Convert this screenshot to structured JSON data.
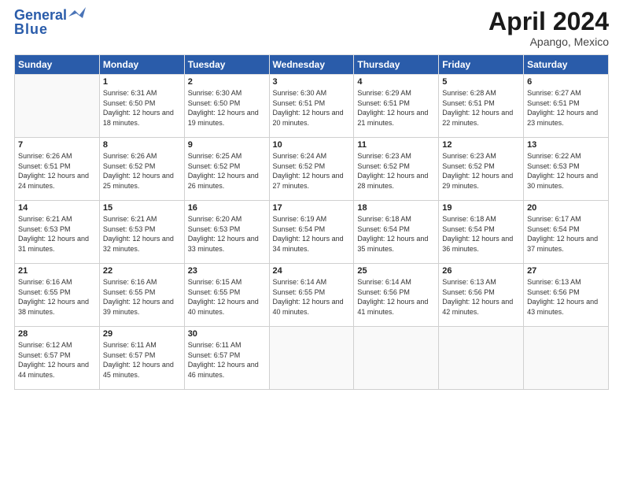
{
  "header": {
    "logo_general": "General",
    "logo_blue": "Blue",
    "title": "April 2024",
    "location": "Apango, Mexico"
  },
  "weekdays": [
    "Sunday",
    "Monday",
    "Tuesday",
    "Wednesday",
    "Thursday",
    "Friday",
    "Saturday"
  ],
  "weeks": [
    [
      {
        "day": "",
        "sunrise": "",
        "sunset": "",
        "daylight": ""
      },
      {
        "day": "1",
        "sunrise": "Sunrise: 6:31 AM",
        "sunset": "Sunset: 6:50 PM",
        "daylight": "Daylight: 12 hours and 18 minutes."
      },
      {
        "day": "2",
        "sunrise": "Sunrise: 6:30 AM",
        "sunset": "Sunset: 6:50 PM",
        "daylight": "Daylight: 12 hours and 19 minutes."
      },
      {
        "day": "3",
        "sunrise": "Sunrise: 6:30 AM",
        "sunset": "Sunset: 6:51 PM",
        "daylight": "Daylight: 12 hours and 20 minutes."
      },
      {
        "day": "4",
        "sunrise": "Sunrise: 6:29 AM",
        "sunset": "Sunset: 6:51 PM",
        "daylight": "Daylight: 12 hours and 21 minutes."
      },
      {
        "day": "5",
        "sunrise": "Sunrise: 6:28 AM",
        "sunset": "Sunset: 6:51 PM",
        "daylight": "Daylight: 12 hours and 22 minutes."
      },
      {
        "day": "6",
        "sunrise": "Sunrise: 6:27 AM",
        "sunset": "Sunset: 6:51 PM",
        "daylight": "Daylight: 12 hours and 23 minutes."
      }
    ],
    [
      {
        "day": "7",
        "sunrise": "Sunrise: 6:26 AM",
        "sunset": "Sunset: 6:51 PM",
        "daylight": "Daylight: 12 hours and 24 minutes."
      },
      {
        "day": "8",
        "sunrise": "Sunrise: 6:26 AM",
        "sunset": "Sunset: 6:52 PM",
        "daylight": "Daylight: 12 hours and 25 minutes."
      },
      {
        "day": "9",
        "sunrise": "Sunrise: 6:25 AM",
        "sunset": "Sunset: 6:52 PM",
        "daylight": "Daylight: 12 hours and 26 minutes."
      },
      {
        "day": "10",
        "sunrise": "Sunrise: 6:24 AM",
        "sunset": "Sunset: 6:52 PM",
        "daylight": "Daylight: 12 hours and 27 minutes."
      },
      {
        "day": "11",
        "sunrise": "Sunrise: 6:23 AM",
        "sunset": "Sunset: 6:52 PM",
        "daylight": "Daylight: 12 hours and 28 minutes."
      },
      {
        "day": "12",
        "sunrise": "Sunrise: 6:23 AM",
        "sunset": "Sunset: 6:52 PM",
        "daylight": "Daylight: 12 hours and 29 minutes."
      },
      {
        "day": "13",
        "sunrise": "Sunrise: 6:22 AM",
        "sunset": "Sunset: 6:53 PM",
        "daylight": "Daylight: 12 hours and 30 minutes."
      }
    ],
    [
      {
        "day": "14",
        "sunrise": "Sunrise: 6:21 AM",
        "sunset": "Sunset: 6:53 PM",
        "daylight": "Daylight: 12 hours and 31 minutes."
      },
      {
        "day": "15",
        "sunrise": "Sunrise: 6:21 AM",
        "sunset": "Sunset: 6:53 PM",
        "daylight": "Daylight: 12 hours and 32 minutes."
      },
      {
        "day": "16",
        "sunrise": "Sunrise: 6:20 AM",
        "sunset": "Sunset: 6:53 PM",
        "daylight": "Daylight: 12 hours and 33 minutes."
      },
      {
        "day": "17",
        "sunrise": "Sunrise: 6:19 AM",
        "sunset": "Sunset: 6:54 PM",
        "daylight": "Daylight: 12 hours and 34 minutes."
      },
      {
        "day": "18",
        "sunrise": "Sunrise: 6:18 AM",
        "sunset": "Sunset: 6:54 PM",
        "daylight": "Daylight: 12 hours and 35 minutes."
      },
      {
        "day": "19",
        "sunrise": "Sunrise: 6:18 AM",
        "sunset": "Sunset: 6:54 PM",
        "daylight": "Daylight: 12 hours and 36 minutes."
      },
      {
        "day": "20",
        "sunrise": "Sunrise: 6:17 AM",
        "sunset": "Sunset: 6:54 PM",
        "daylight": "Daylight: 12 hours and 37 minutes."
      }
    ],
    [
      {
        "day": "21",
        "sunrise": "Sunrise: 6:16 AM",
        "sunset": "Sunset: 6:55 PM",
        "daylight": "Daylight: 12 hours and 38 minutes."
      },
      {
        "day": "22",
        "sunrise": "Sunrise: 6:16 AM",
        "sunset": "Sunset: 6:55 PM",
        "daylight": "Daylight: 12 hours and 39 minutes."
      },
      {
        "day": "23",
        "sunrise": "Sunrise: 6:15 AM",
        "sunset": "Sunset: 6:55 PM",
        "daylight": "Daylight: 12 hours and 40 minutes."
      },
      {
        "day": "24",
        "sunrise": "Sunrise: 6:14 AM",
        "sunset": "Sunset: 6:55 PM",
        "daylight": "Daylight: 12 hours and 40 minutes."
      },
      {
        "day": "25",
        "sunrise": "Sunrise: 6:14 AM",
        "sunset": "Sunset: 6:56 PM",
        "daylight": "Daylight: 12 hours and 41 minutes."
      },
      {
        "day": "26",
        "sunrise": "Sunrise: 6:13 AM",
        "sunset": "Sunset: 6:56 PM",
        "daylight": "Daylight: 12 hours and 42 minutes."
      },
      {
        "day": "27",
        "sunrise": "Sunrise: 6:13 AM",
        "sunset": "Sunset: 6:56 PM",
        "daylight": "Daylight: 12 hours and 43 minutes."
      }
    ],
    [
      {
        "day": "28",
        "sunrise": "Sunrise: 6:12 AM",
        "sunset": "Sunset: 6:57 PM",
        "daylight": "Daylight: 12 hours and 44 minutes."
      },
      {
        "day": "29",
        "sunrise": "Sunrise: 6:11 AM",
        "sunset": "Sunset: 6:57 PM",
        "daylight": "Daylight: 12 hours and 45 minutes."
      },
      {
        "day": "30",
        "sunrise": "Sunrise: 6:11 AM",
        "sunset": "Sunset: 6:57 PM",
        "daylight": "Daylight: 12 hours and 46 minutes."
      },
      {
        "day": "",
        "sunrise": "",
        "sunset": "",
        "daylight": ""
      },
      {
        "day": "",
        "sunrise": "",
        "sunset": "",
        "daylight": ""
      },
      {
        "day": "",
        "sunrise": "",
        "sunset": "",
        "daylight": ""
      },
      {
        "day": "",
        "sunrise": "",
        "sunset": "",
        "daylight": ""
      }
    ]
  ]
}
